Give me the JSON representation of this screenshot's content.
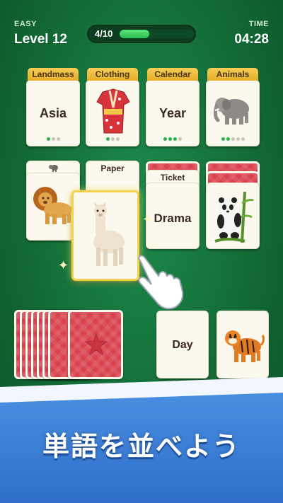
{
  "header": {
    "difficulty": "EASY",
    "level": "Level 12",
    "progress_label": "4/10",
    "progress_fraction": 0.4,
    "time_label": "TIME",
    "time_value": "04:28"
  },
  "categories": [
    {
      "tab": "Landmass",
      "word": "Asia",
      "dots_filled": 1,
      "dots_total": 3
    },
    {
      "tab": "Clothing",
      "image": "kimono",
      "dots_filled": 1,
      "dots_total": 3
    },
    {
      "tab": "Calendar",
      "word": "Year",
      "dots_filled": 3,
      "dots_total": 4
    },
    {
      "tab": "Animals",
      "image": "elephant",
      "dots_filled": 2,
      "dots_total": 5
    }
  ],
  "board": {
    "col1_peek": "elephant-mini",
    "col1_image": "lion",
    "col2_peek": "Paper",
    "dragged_card_image": "alpaca",
    "col3_peek": "Ticket",
    "col3_word": "Drama",
    "col4_image": "panda"
  },
  "bottom": {
    "open_card_word": "Day",
    "open_card_image": "tiger"
  },
  "banner": {
    "text": "単語を並べよう"
  },
  "colors": {
    "felt": "#136b36",
    "tab_gold": "#e6ae2a",
    "card_back": "#d9434f",
    "progress_green": "#2fbf55",
    "banner_blue": "#2f6fc9"
  }
}
